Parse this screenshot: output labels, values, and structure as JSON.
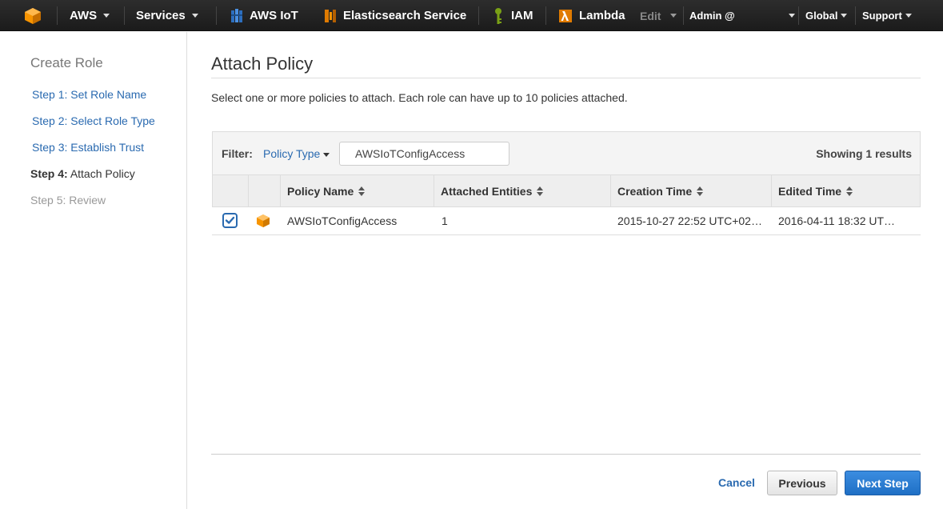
{
  "topnav": {
    "logo_icon": "aws-cube-icon",
    "aws_label": "AWS",
    "services_label": "Services",
    "shortcuts": [
      {
        "icon": "aws-iot-icon",
        "label": "AWS IoT"
      },
      {
        "icon": "elasticsearch-icon",
        "label": "Elasticsearch Service"
      },
      {
        "icon": "iam-icon",
        "label": "IAM"
      },
      {
        "icon": "lambda-icon",
        "label": "Lambda"
      }
    ],
    "edit_label": "Edit",
    "account_label": "Admin @",
    "region_label": "Global",
    "support_label": "Support"
  },
  "sidebar": {
    "title": "Create Role",
    "steps": [
      {
        "label": "Step 1: Set Role Name",
        "state": "link"
      },
      {
        "label": "Step 2: Select Role Type",
        "state": "link"
      },
      {
        "label": "Step 3: Establish Trust",
        "state": "link"
      },
      {
        "prefix": "Step 4:",
        "label": "Attach Policy",
        "state": "current"
      },
      {
        "label": "Step 5: Review",
        "state": "disabled"
      }
    ]
  },
  "main": {
    "title": "Attach Policy",
    "description": "Select one or more policies to attach. Each role can have up to 10 policies attached.",
    "filter": {
      "label": "Filter:",
      "type_label": "Policy Type",
      "search_value": "AWSIoTConfigAccess",
      "results_text": "Showing 1 results"
    },
    "table": {
      "columns": [
        "Policy Name",
        "Attached Entities",
        "Creation Time",
        "Edited Time"
      ],
      "rows": [
        {
          "checked": true,
          "icon": "policy-cube-icon",
          "policy_name": "AWSIoTConfigAccess",
          "attached_entities": "1",
          "creation_time": "2015-10-27 22:52 UTC+02…",
          "edited_time": "2016-04-11 18:32 UT…"
        }
      ]
    },
    "footer": {
      "cancel_label": "Cancel",
      "previous_label": "Previous",
      "next_label": "Next Step"
    }
  },
  "colors": {
    "link": "#2a6ab0",
    "primary_button": "#2a7bd6",
    "aws_orange": "#f79400"
  }
}
